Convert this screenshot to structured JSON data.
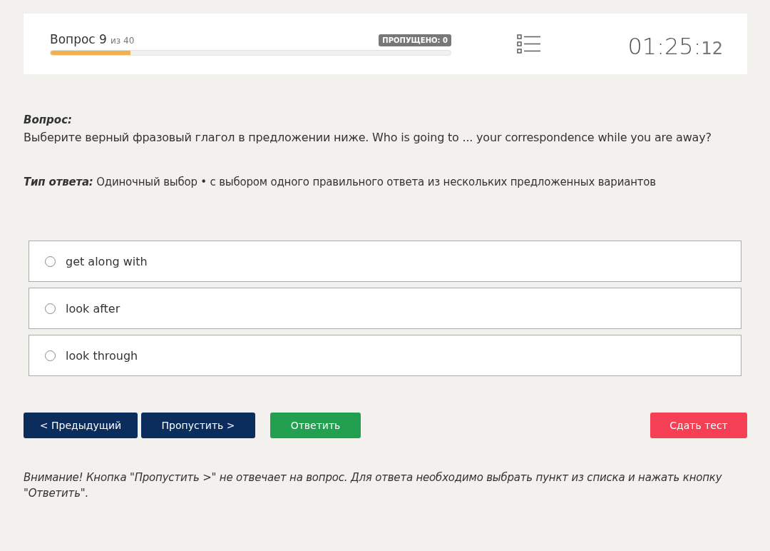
{
  "header": {
    "question_label": "Вопрос 9",
    "question_total": "из 40",
    "progress": {
      "level": 0.2
    },
    "skipped_badge": "ПРОПУЩЕНО: 0",
    "timer_main": "01:25:",
    "timer_seconds": "12"
  },
  "question": {
    "heading": "Вопрос:",
    "text": "Выберите верный фразовый глагол в предложении ниже. Who is going to ... your correspondence while you are away?"
  },
  "answer_type": {
    "label": "Тип ответа:",
    "value": "Одиночный выбор • с выбором одного правильного ответа из нескольких предложенных вариантов"
  },
  "options": [
    {
      "label": "get along with",
      "selected": false
    },
    {
      "label": "look after",
      "selected": false
    },
    {
      "label": "look through",
      "selected": false
    }
  ],
  "buttons": [
    {
      "label": "< Предыдущий",
      "kind": "nav"
    },
    {
      "label": "Пропустить >",
      "kind": "nav"
    },
    {
      "label": "Ответить",
      "kind": "answer"
    },
    {
      "label": "Сдать тест",
      "kind": "finish"
    }
  ],
  "notice": "Внимание! Кнопка \"Пропустить >\" не отвечает на вопрос. Для ответа необходимо выбрать пункт из списка и нажать кнопку \"Ответить\"."
}
